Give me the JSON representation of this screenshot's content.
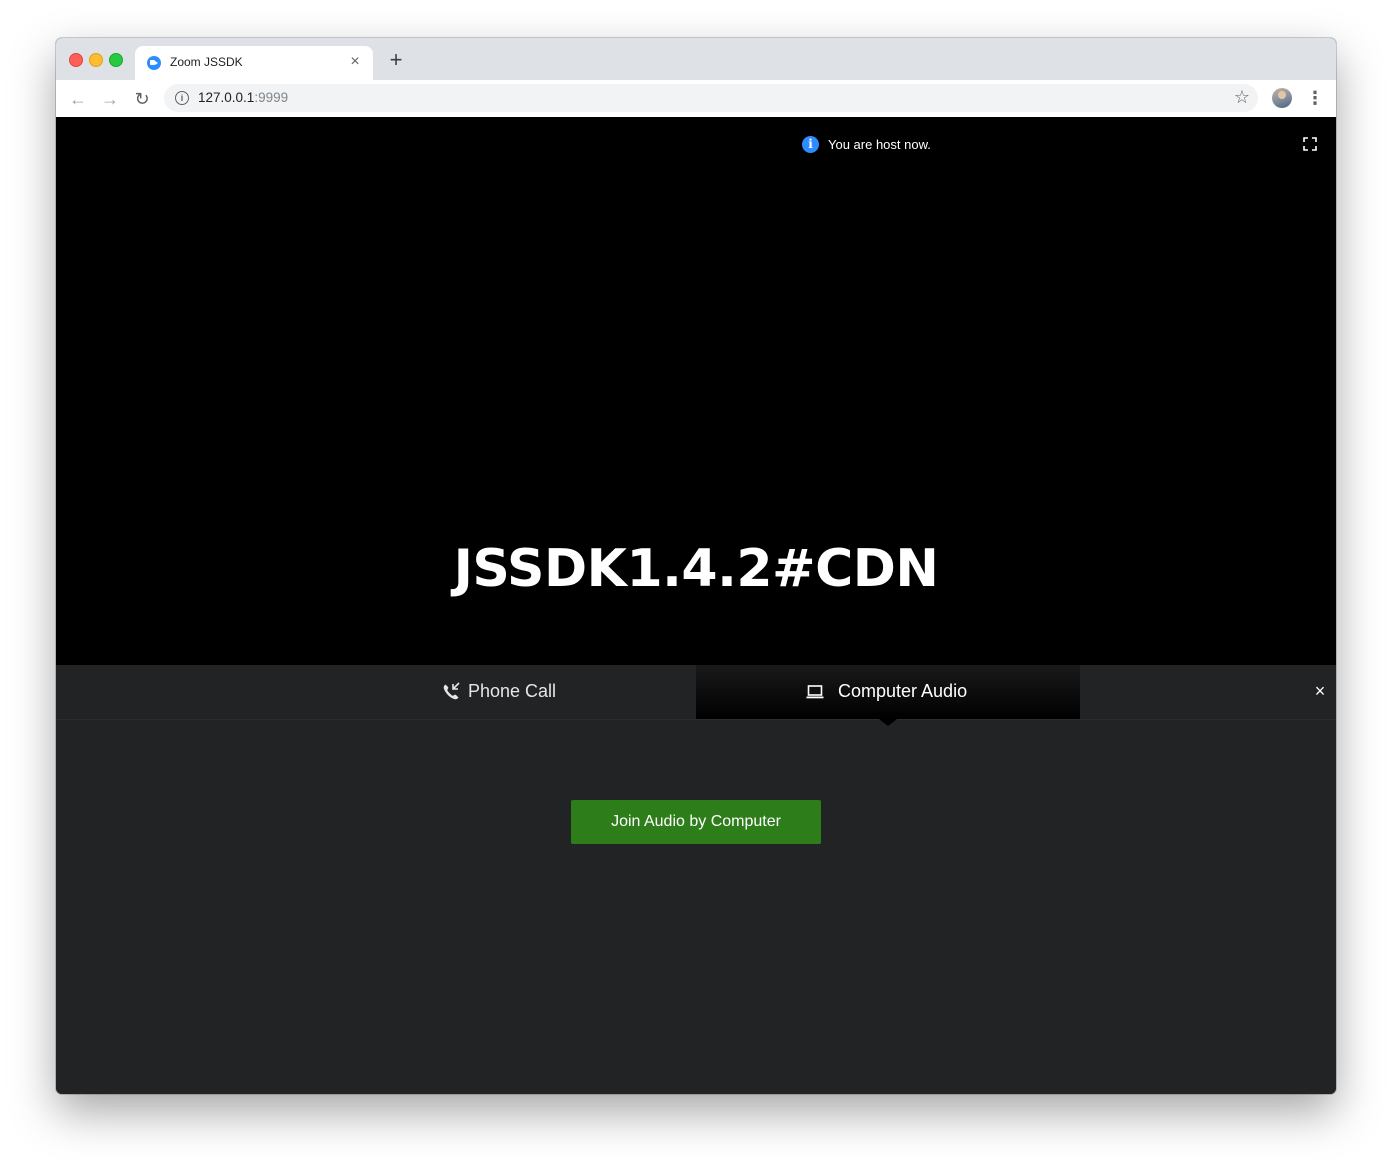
{
  "browser": {
    "tab_title": "Zoom JSSDK",
    "tab_close_glyph": "×",
    "new_tab_glyph": "+",
    "back_glyph": "←",
    "forward_glyph": "→",
    "reload_glyph": "↻",
    "info_glyph": "i",
    "url_host": "127.0.0.1",
    "url_port": ":9999",
    "star_glyph": "☆",
    "menu_glyph": "⋮",
    "favicon_icon": "zoom-camera-icon"
  },
  "meeting": {
    "host_notice": "You are host now.",
    "host_notice_icon": "info-icon",
    "host_info_glyph": "i",
    "title": "JSSDK1.4.2#CDN"
  },
  "audio_panel": {
    "tabs": [
      {
        "label": "Phone Call",
        "icon": "phone-call-icon",
        "active": false
      },
      {
        "label": "Computer Audio",
        "icon": "laptop-icon",
        "active": true
      }
    ],
    "close_glyph": "×",
    "join_button_label": "Join Audio by Computer",
    "join_button_color": "#2d7d1a"
  },
  "colors": {
    "video_background": "#000000",
    "panel_background": "#222325",
    "zoom_blue": "#2d8cff"
  }
}
